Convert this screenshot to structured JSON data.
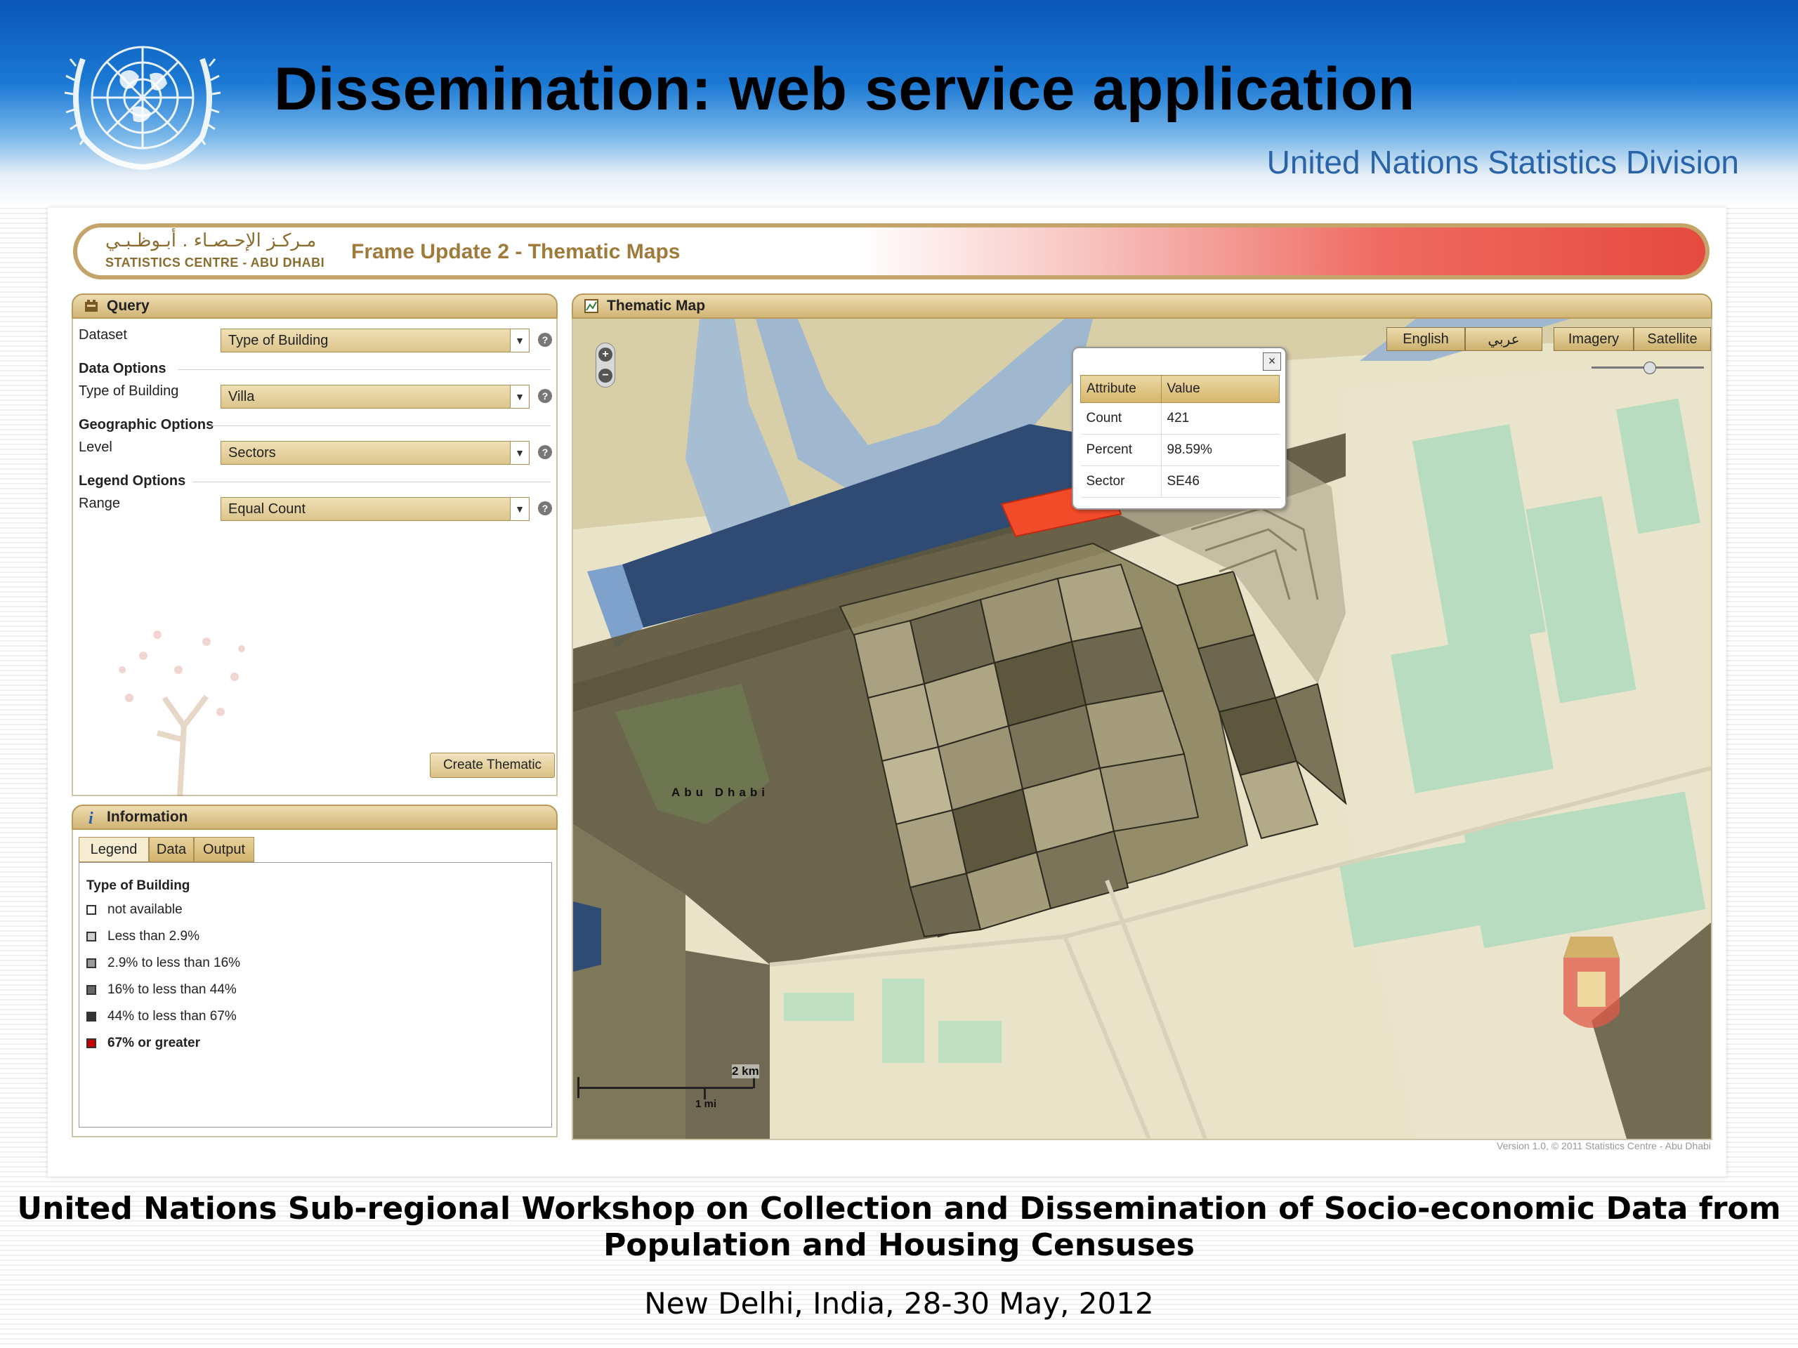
{
  "slide": {
    "title": "Dissemination: web service application",
    "organization": "United Nations Statistics Division",
    "footer_title_line1": "United Nations Sub-regional Workshop on Collection and Dissemination of Socio-economic Data from",
    "footer_title_line2": "Population and Housing Censuses",
    "footer_subtitle": "New Delhi, India, 28-30 May, 2012"
  },
  "app": {
    "logo_arabic": "مـركـز الإحـصـاء . أبـوظـبـي",
    "logo_english": "STATISTICS CENTRE - ABU DHABI",
    "title": "Frame Update 2 - Thematic Maps",
    "version": "Version 1.0, © 2011 Statistics Centre - Abu Dhabi"
  },
  "query": {
    "header": "Query",
    "dataset_label": "Dataset",
    "dataset_value": "Type of Building",
    "data_options_heading": "Data Options",
    "type_of_building_label": "Type of Building",
    "type_of_building_value": "Villa",
    "geographic_options_heading": "Geographic Options",
    "level_label": "Level",
    "level_value": "Sectors",
    "legend_options_heading": "Legend Options",
    "range_label": "Range",
    "range_value": "Equal Count",
    "create_button": "Create Thematic"
  },
  "information": {
    "header": "Information",
    "tabs": [
      "Legend",
      "Data",
      "Output"
    ],
    "active_tab": "Legend",
    "legend_title": "Type of Building",
    "legend_items": [
      {
        "label": "not available",
        "color": "#ffffff"
      },
      {
        "label": "Less than  2.9%",
        "color": "#cfcfcf"
      },
      {
        "label": "2.9%  to less than   16%",
        "color": "#9a9a9a"
      },
      {
        "label": "16%  to less than   44%",
        "color": "#666666"
      },
      {
        "label": "44%  to less than   67%",
        "color": "#333333"
      },
      {
        "label": "67%  or greater",
        "color": "#cc0000"
      }
    ]
  },
  "map": {
    "header": "Thematic Map",
    "lang_english": "English",
    "lang_arabic": "عربي",
    "imagery_button": "Imagery",
    "satellite_button": "Satellite",
    "zoom_in": "+",
    "zoom_out": "−",
    "place_label": "Abu  Dhabi",
    "scale_km": "2 km",
    "scale_mi": "1 mi",
    "popup": {
      "close": "×",
      "col_attribute": "Attribute",
      "col_value": "Value",
      "rows": [
        {
          "attribute": "Count",
          "value": "421"
        },
        {
          "attribute": "Percent",
          "value": "98.59%"
        },
        {
          "attribute": "Sector",
          "value": "SE46"
        }
      ]
    },
    "colors": {
      "water": "#9cb3cc",
      "dark_water": "#2e4670",
      "land": "#ebe4c8",
      "park": "#bfe0c2",
      "sector_dark": "#5c5740",
      "highlight": "#f24b2a"
    }
  }
}
